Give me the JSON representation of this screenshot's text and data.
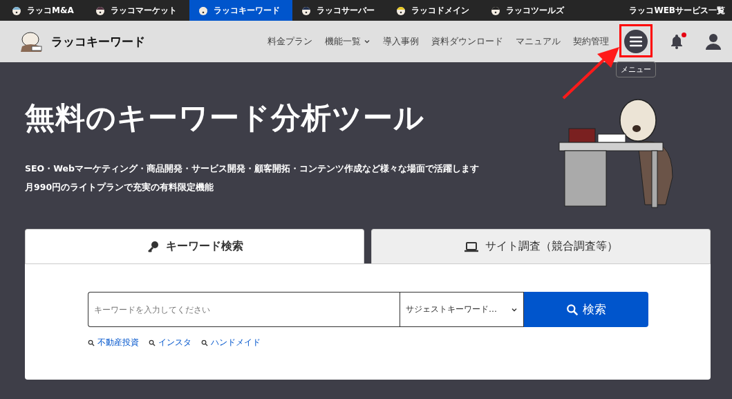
{
  "service_bar": {
    "items": [
      {
        "label": "ラッコM&A",
        "selected": false
      },
      {
        "label": "ラッコマーケット",
        "selected": false
      },
      {
        "label": "ラッコキーワード",
        "selected": true
      },
      {
        "label": "ラッコサーバー",
        "selected": false
      },
      {
        "label": "ラッコドメイン",
        "selected": false
      },
      {
        "label": "ラッコツールズ",
        "selected": false
      }
    ],
    "all_services": "ラッコWEBサービス一覧"
  },
  "header": {
    "logo": "ラッコキーワード",
    "nav": [
      {
        "label": "料金プラン",
        "dropdown": false
      },
      {
        "label": "機能一覧",
        "dropdown": true
      },
      {
        "label": "導入事例",
        "dropdown": false
      },
      {
        "label": "資料ダウンロード",
        "dropdown": false
      },
      {
        "label": "マニュアル",
        "dropdown": false
      },
      {
        "label": "契約管理",
        "dropdown": false
      }
    ],
    "menu_tooltip": "メニュー",
    "notification": true,
    "highlight_menu": true
  },
  "hero": {
    "title": "無料のキーワード分析ツール",
    "lines": [
      "SEO・Webマーケティング・商品開発・サービス開発・顧客開拓・コンテンツ作成など様々な場面で活躍します",
      "月990円のライトプランで充実の有料限定機能"
    ]
  },
  "search": {
    "tabs": [
      {
        "label": "キーワード検索",
        "kind": "key",
        "selected": true
      },
      {
        "label": "サイト調査（競合調査等）",
        "kind": "laptop",
        "selected": false
      }
    ],
    "placeholder": "キーワードを入力してください",
    "mode": "サジェストキーワード…",
    "button": "検索",
    "examples": [
      "不動産投資",
      "インスタ",
      "ハンドメイド"
    ]
  }
}
